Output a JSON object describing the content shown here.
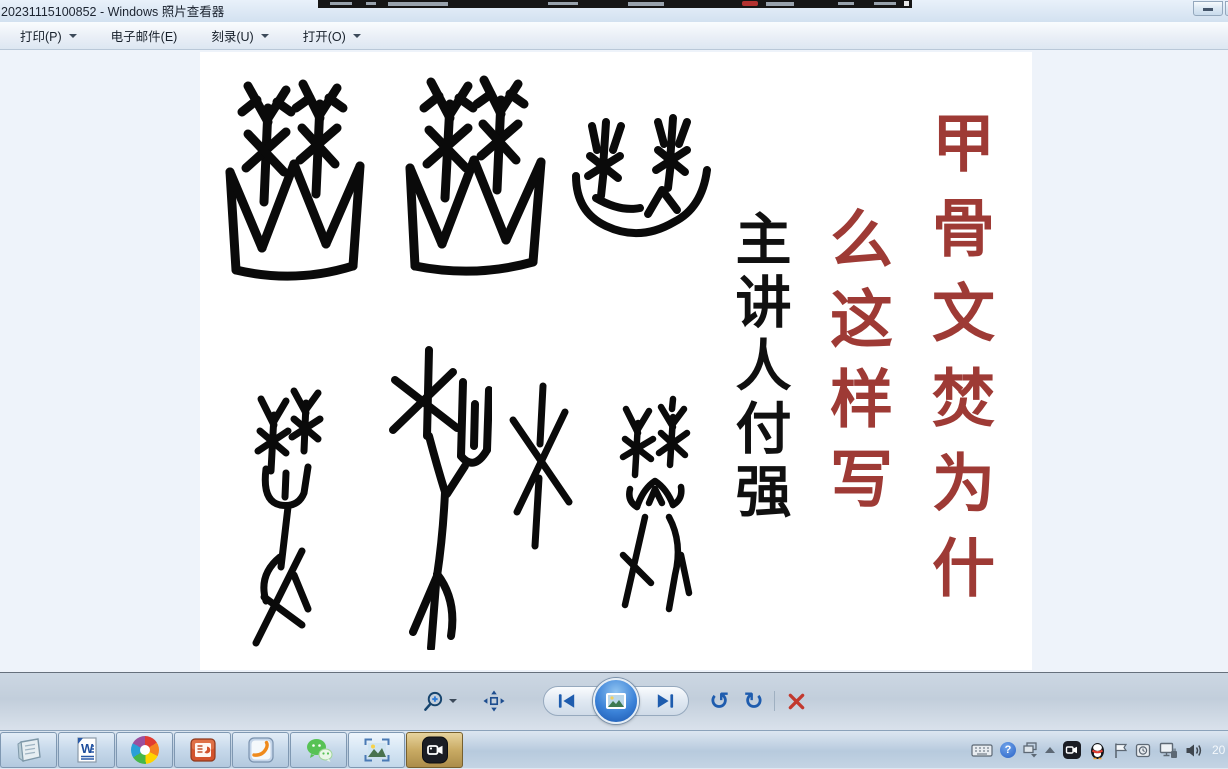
{
  "background_bar": {
    "name": "screen-recorder-bar-fragment"
  },
  "window": {
    "title": "20231115100852 - Windows 照片查看器",
    "menu": [
      {
        "label": "打印(P)",
        "caret": true
      },
      {
        "label": "电子邮件(E)",
        "caret": false
      },
      {
        "label": "刻录(U)",
        "caret": true
      },
      {
        "label": "打开(O)",
        "caret": true
      }
    ],
    "controls": {
      "minimize_icon": "minimize-icon"
    }
  },
  "slide": {
    "title_column_right": "甲骨文焚为什",
    "title_column_left": "么这样写",
    "title_full": "甲骨文焚为什么这样写",
    "lecturer": "主讲人付强",
    "title_color": "#9e3a35",
    "glyph_names": [
      "oracle-fen-trees-over-fire-1",
      "oracle-fen-trees-over-fire-2",
      "oracle-fen-plants-over-basin",
      "oracle-plant-and-hand",
      "oracle-tall-tree-fork",
      "oracle-crossed-branches",
      "oracle-plants-over-figure"
    ]
  },
  "viewer_toolbar": {
    "icons": [
      "zoom-icon",
      "fit-to-window-icon",
      "previous-icon",
      "slideshow-play-icon",
      "next-icon",
      "rotate-ccw-icon",
      "rotate-cw-icon",
      "delete-icon"
    ],
    "rotate_ccw_glyph": "↺",
    "rotate_cw_glyph": "↻"
  },
  "taskbar": {
    "apps": [
      "notepad",
      "word",
      "browser",
      "powerpoint",
      "foxit-reader",
      "wechat",
      "photo-viewer",
      "screen-recorder"
    ],
    "tray_icons": [
      "keyboard",
      "input-help",
      "window-stack",
      "show-hidden-chevron",
      "recorder",
      "qq",
      "action-center-flag",
      "clock-utility",
      "network",
      "volume"
    ],
    "clock": "20",
    "help_glyph": "?"
  },
  "colors": {
    "accent_red": "#9e3a35",
    "toolbar_blue": "#1e5cae",
    "delete_red": "#c2392e"
  }
}
